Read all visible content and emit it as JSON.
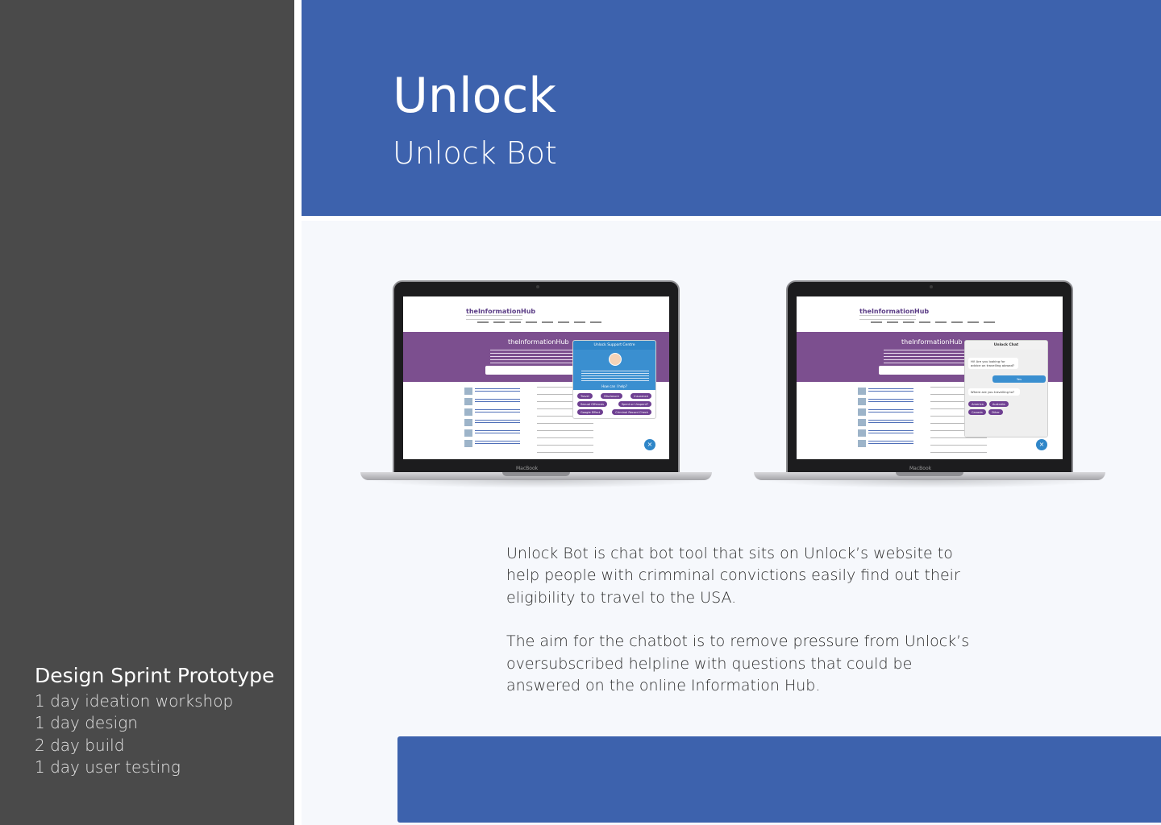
{
  "header": {
    "title": "Unlock",
    "subtitle": "Unlock Bot"
  },
  "sidebar": {
    "sprint_title": "Design Sprint Prototype",
    "sprint_items": [
      "1 day ideation workshop",
      "1 day design",
      "2 day build",
      "1 day user testing"
    ]
  },
  "description": {
    "paragraphs": [
      "Unlock Bot is chat bot tool that sits on Unlock’s website to help people with crimminal convictions easily find out their eligibility to travel to the USA.",
      "The aim for the chatbot is to remove pressure from Unlock’s oversubscribed helpline with questions that could be answered on the online Information Hub."
    ]
  },
  "laptop_left": {
    "brand": "MacBook",
    "site_logo": "theInformationHub",
    "hero_title": "theInformationHub",
    "widget_title": "Unlock Support Centre",
    "widget_question": "How can I help?",
    "chips": [
      "Travel",
      "Disclosure",
      "Insurance",
      "Sexual Offences",
      "Spent or Unspent?",
      "Google Effect",
      "Criminal Record Check"
    ]
  },
  "laptop_right": {
    "brand": "MacBook",
    "site_logo": "theInformationHub",
    "hero_title": "theInformationHub",
    "chat_title": "Unlock Chat",
    "bot_msg_1": "Hi! Are you looking for advice on travelling abroad?",
    "user_msg_1": "Yes",
    "bot_msg_2": "Where are you travelling to?",
    "chips": [
      "America",
      "Australia",
      "Canada",
      "Other"
    ]
  },
  "colors": {
    "sidebar": "#4a4a4a",
    "header": "#3d62ad",
    "content_bg": "#f6f8fc",
    "hero_purple": "#7c4f8f",
    "chip_purple": "#6e3f91",
    "widget_blue": "#2f86c8"
  },
  "icons": {
    "close": "close-icon"
  }
}
